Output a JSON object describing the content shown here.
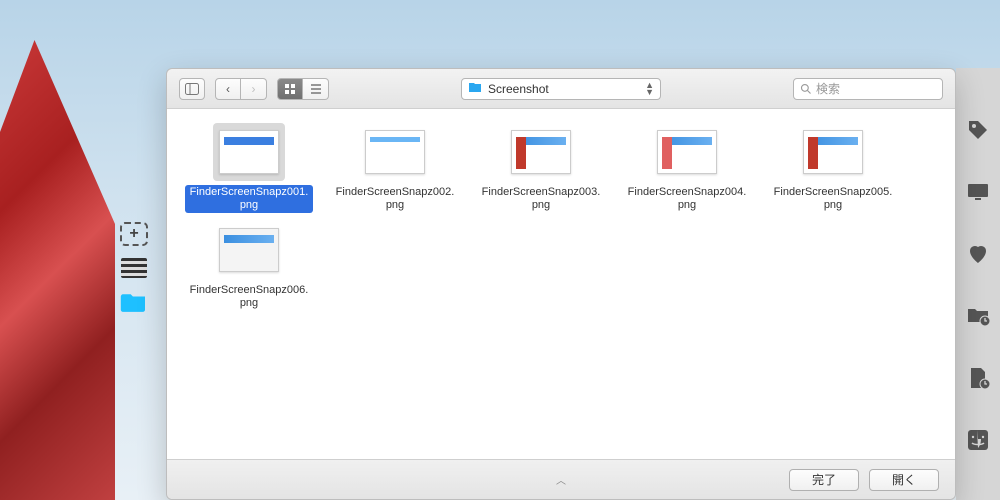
{
  "toolbar": {
    "path_label": "Screenshot",
    "search_placeholder": "検索"
  },
  "files": [
    {
      "name": "FinderScreenSnapz001.png",
      "selected": true,
      "thumb": "t1"
    },
    {
      "name": "FinderScreenSnapz002.png",
      "selected": false,
      "thumb": "t2"
    },
    {
      "name": "FinderScreenSnapz003.png",
      "selected": false,
      "thumb": "t3"
    },
    {
      "name": "FinderScreenSnapz004.png",
      "selected": false,
      "thumb": "t4"
    },
    {
      "name": "FinderScreenSnapz005.png",
      "selected": false,
      "thumb": "t5"
    },
    {
      "name": "FinderScreenSnapz006.png",
      "selected": false,
      "thumb": "t6"
    }
  ],
  "buttons": {
    "done": "完了",
    "open": "開く"
  },
  "right_sidebar_icons": [
    "tag-icon",
    "display-icon",
    "heart-icon",
    "folder-clock-icon",
    "file-clock-icon",
    "finder-icon"
  ],
  "desktop_strip_icons": [
    "add-icon",
    "bars-icon",
    "folder-blue-icon"
  ]
}
